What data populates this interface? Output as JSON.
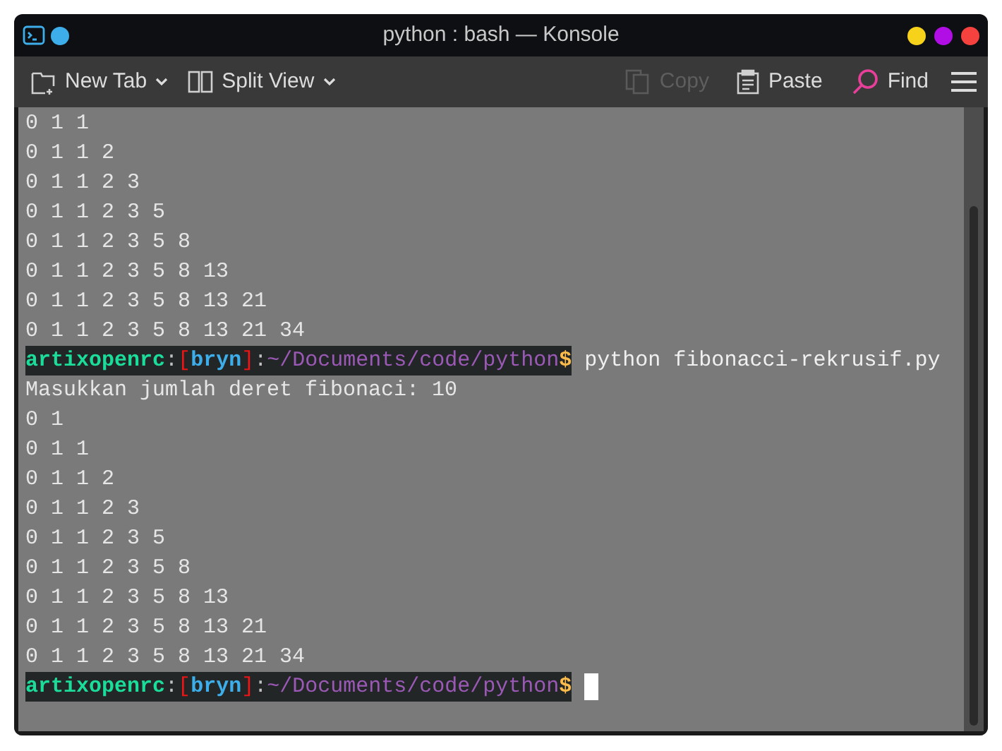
{
  "window": {
    "title": "python : bash — Konsole"
  },
  "toolbar": {
    "left": [
      {
        "label": "New Tab",
        "kind": "new-tab",
        "disabled": false
      },
      {
        "label": "Split View",
        "kind": "split",
        "disabled": false
      }
    ],
    "right": [
      {
        "label": "Copy",
        "kind": "copy",
        "disabled": true
      },
      {
        "label": "Paste",
        "kind": "paste",
        "disabled": false
      },
      {
        "label": "Find",
        "kind": "find",
        "disabled": false
      }
    ]
  },
  "terminal": {
    "lines": [
      {
        "kind": "output",
        "text": "0 1 1"
      },
      {
        "kind": "output",
        "text": "0 1 1 2"
      },
      {
        "kind": "output",
        "text": "0 1 1 2 3"
      },
      {
        "kind": "output",
        "text": "0 1 1 2 3 5"
      },
      {
        "kind": "output",
        "text": "0 1 1 2 3 5 8"
      },
      {
        "kind": "output",
        "text": "0 1 1 2 3 5 8 13"
      },
      {
        "kind": "output",
        "text": "0 1 1 2 3 5 8 13 21"
      },
      {
        "kind": "output",
        "text": "0 1 1 2 3 5 8 13 21 34"
      },
      {
        "kind": "prompt",
        "host": "artixopenrc",
        "sep1": ":",
        "open": "[",
        "user": "bryn",
        "close": "]",
        "sep2": ":",
        "path": "~/Documents/code/python",
        "symbol": "$",
        "command": "python fibonacci-rekrusif.py"
      },
      {
        "kind": "output",
        "text": "Masukkan jumlah deret fibonaci: 10"
      },
      {
        "kind": "output",
        "text": "0 1"
      },
      {
        "kind": "output",
        "text": "0 1 1"
      },
      {
        "kind": "output",
        "text": "0 1 1 2"
      },
      {
        "kind": "output",
        "text": "0 1 1 2 3"
      },
      {
        "kind": "output",
        "text": "0 1 1 2 3 5"
      },
      {
        "kind": "output",
        "text": "0 1 1 2 3 5 8"
      },
      {
        "kind": "output",
        "text": "0 1 1 2 3 5 8 13"
      },
      {
        "kind": "output",
        "text": "0 1 1 2 3 5 8 13 21"
      },
      {
        "kind": "output",
        "text": "0 1 1 2 3 5 8 13 21 34"
      },
      {
        "kind": "prompt",
        "host": "artixopenrc",
        "sep1": ":",
        "open": "[",
        "user": "bryn",
        "close": "]",
        "sep2": ":",
        "path": "~/Documents/code/python",
        "symbol": "$",
        "cursor": true
      }
    ]
  }
}
